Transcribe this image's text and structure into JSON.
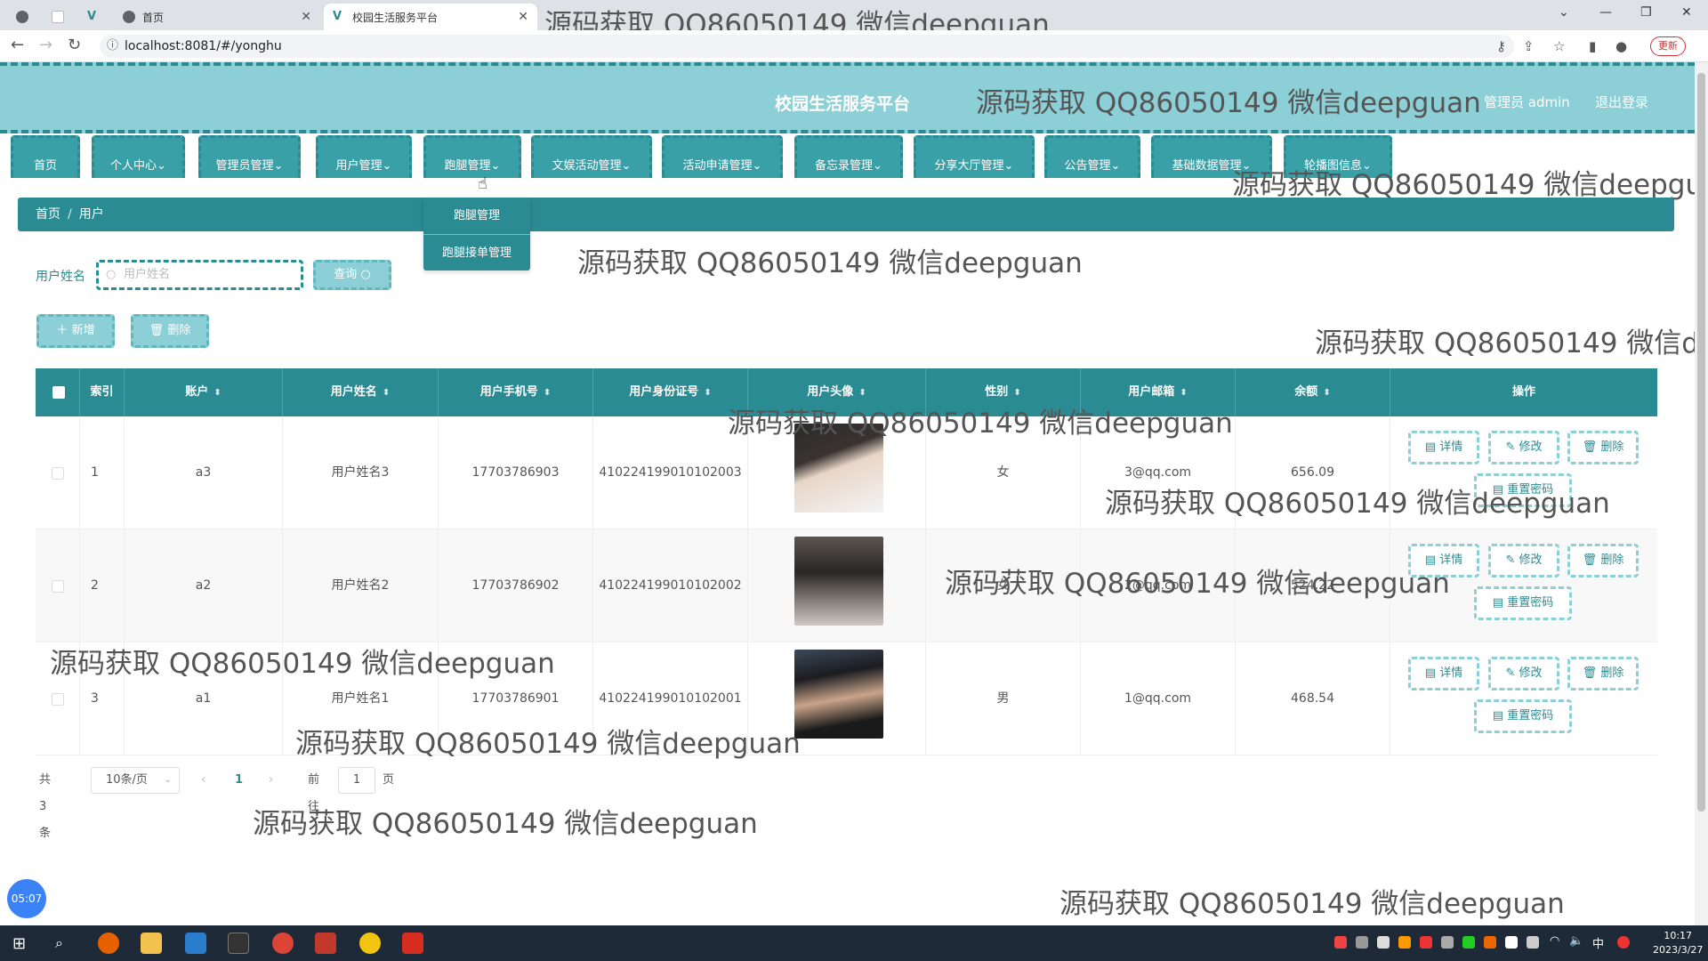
{
  "browser": {
    "tabs": [
      {
        "label": ""
      },
      {
        "label": ""
      },
      {
        "label": ""
      },
      {
        "label": "首页"
      },
      {
        "label": "校园生活服务平台"
      }
    ],
    "url": "localhost:8081/#/yonghu",
    "update_label": "更新"
  },
  "watermark": "源码获取 QQ86050149 微信deepguan",
  "header": {
    "title": "校园生活服务平台",
    "admin_label": "管理员 admin",
    "logout_label": "退出登录"
  },
  "nav": {
    "items": [
      {
        "label": "首页"
      },
      {
        "label": "个人中心"
      },
      {
        "label": "管理员管理"
      },
      {
        "label": "用户管理"
      },
      {
        "label": "跑腿管理"
      },
      {
        "label": "文娱活动管理"
      },
      {
        "label": "活动申请管理"
      },
      {
        "label": "备忘录管理"
      },
      {
        "label": "分享大厅管理"
      },
      {
        "label": "公告管理"
      },
      {
        "label": "基础数据管理"
      },
      {
        "label": "轮播图信息"
      }
    ],
    "dropdown": [
      {
        "label": "跑腿管理"
      },
      {
        "label": "跑腿接单管理"
      }
    ]
  },
  "breadcrumb": {
    "home": "首页",
    "sep": "/",
    "current": "用户"
  },
  "search": {
    "label": "用户姓名",
    "placeholder": "用户姓名",
    "query_label": "查询"
  },
  "actions": {
    "add_label": "新增",
    "delete_label": "删除"
  },
  "table": {
    "headers": [
      "索引",
      "账户",
      "用户姓名",
      "用户手机号",
      "用户身份证号",
      "用户头像",
      "性别",
      "用户邮箱",
      "余额",
      "操作"
    ],
    "rows": [
      {
        "index": "1",
        "account": "a3",
        "name": "用户姓名3",
        "phone": "17703786903",
        "id_card": "410224199010102003",
        "gender": "女",
        "email": "3@qq.com",
        "balance": "656.09"
      },
      {
        "index": "2",
        "account": "a2",
        "name": "用户姓名2",
        "phone": "17703786902",
        "id_card": "410224199010102002",
        "gender": "女",
        "email": "2@qq.com",
        "balance": "524.22"
      },
      {
        "index": "3",
        "account": "a1",
        "name": "用户姓名1",
        "phone": "17703786901",
        "id_card": "410224199010102001",
        "gender": "男",
        "email": "1@qq.com",
        "balance": "468.54"
      }
    ],
    "row_actions": {
      "detail": "详情",
      "edit": "修改",
      "delete": "删除",
      "reset": "重置密码"
    }
  },
  "pagination": {
    "total": "共 3 条",
    "page_size": "10条/页",
    "current": "1",
    "goto_prefix": "前往",
    "goto_value": "1",
    "goto_suffix": "页"
  },
  "timer": "05:07",
  "taskbar": {
    "time": "10:17",
    "date": "2023/3/27"
  },
  "colors": {
    "primary": "#2b8b92",
    "light": "#8dcfd6"
  }
}
